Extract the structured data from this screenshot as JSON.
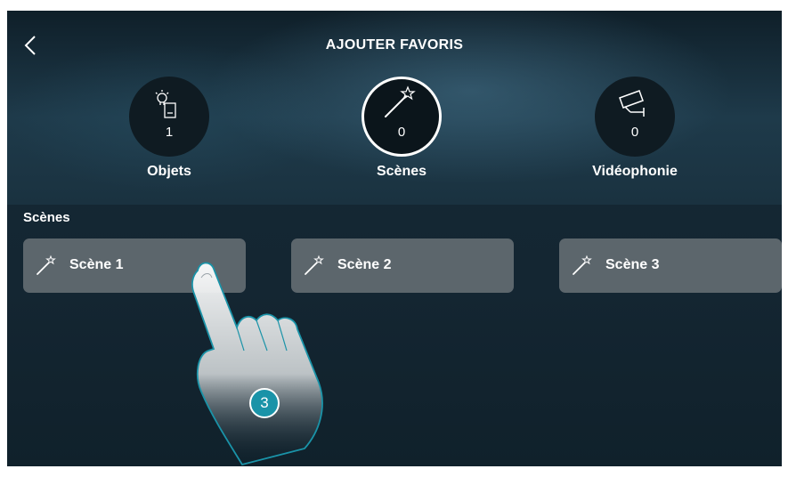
{
  "header": {
    "title": "AJOUTER FAVORIS",
    "back_icon": "chevron-left-icon"
  },
  "categories": [
    {
      "label": "Objets",
      "count": "1",
      "icon": "bulb-switch-icon",
      "selected": false
    },
    {
      "label": "Scènes",
      "count": "0",
      "icon": "magic-wand-icon",
      "selected": true
    },
    {
      "label": "Vidéophonie",
      "count": "0",
      "icon": "camera-icon",
      "selected": false
    }
  ],
  "section": {
    "title": "Scènes"
  },
  "scenes": [
    {
      "label": "Scène 1",
      "icon": "magic-wand-icon"
    },
    {
      "label": "Scène 2",
      "icon": "magic-wand-icon"
    },
    {
      "label": "Scène 3",
      "icon": "magic-wand-icon"
    }
  ],
  "annotation": {
    "step": "3",
    "icon": "pointing-hand-icon"
  },
  "colors": {
    "accent": "#1a93a8",
    "button": "#5c666c",
    "background": "#142632"
  }
}
